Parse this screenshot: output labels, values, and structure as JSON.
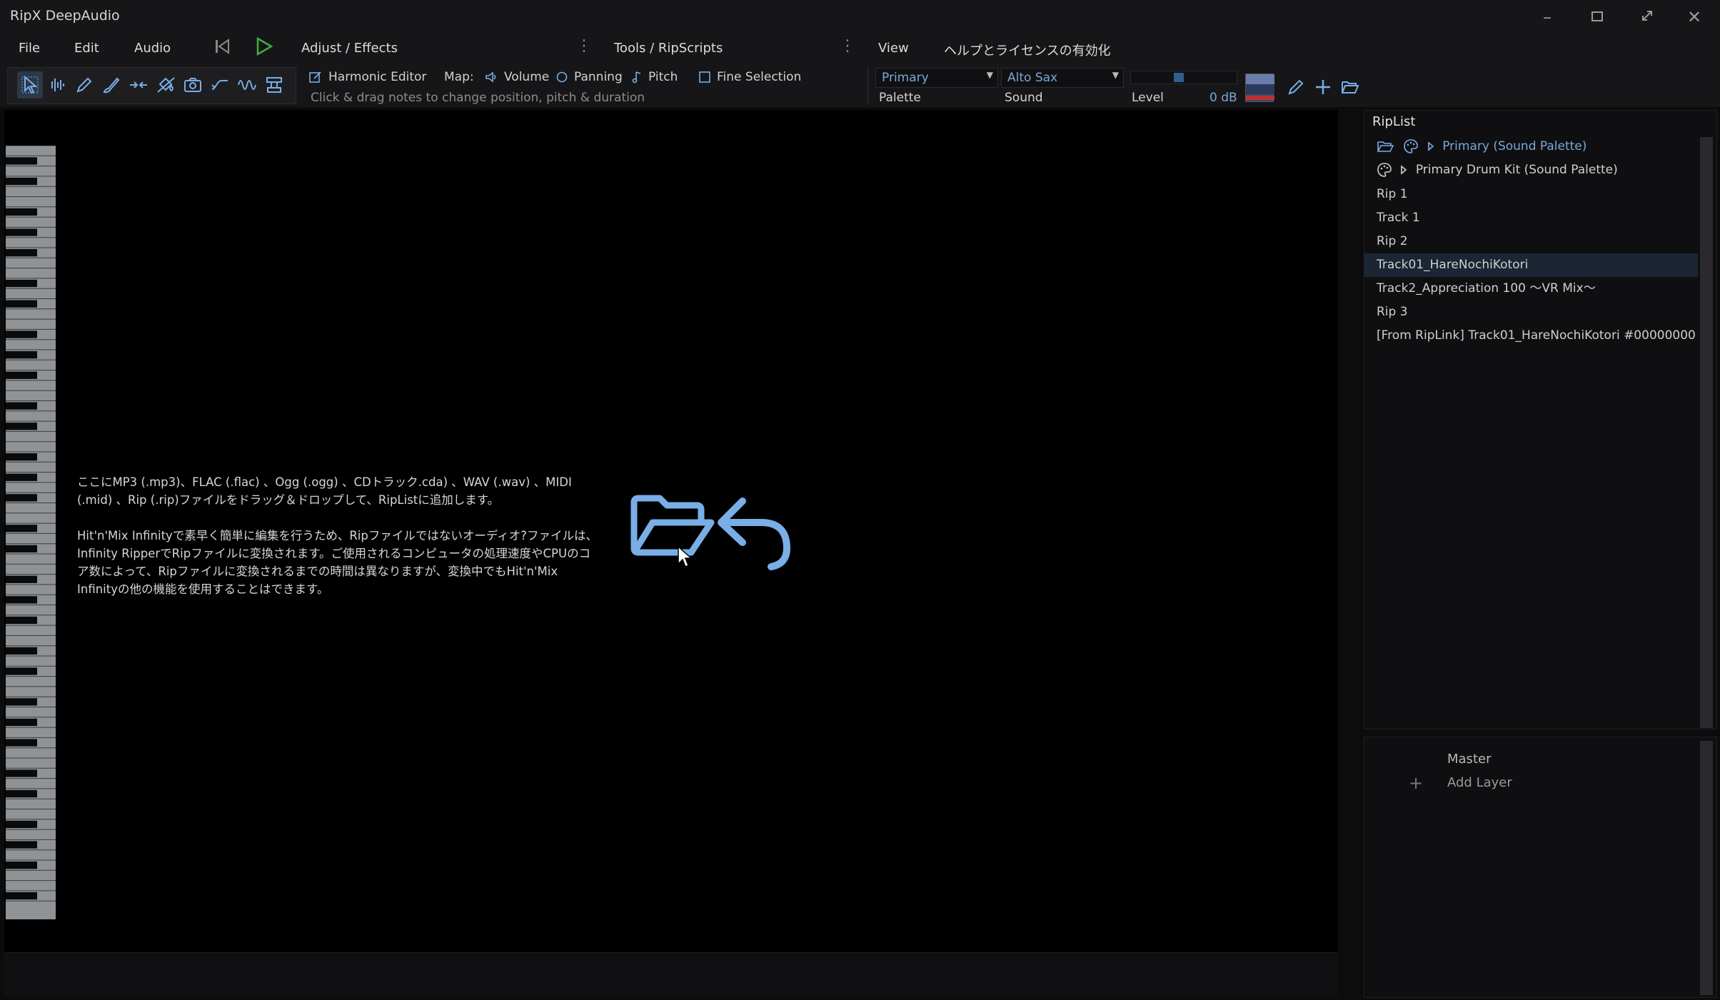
{
  "app": {
    "title": "RipX DeepAudio"
  },
  "menu": {
    "file": "File",
    "edit": "Edit",
    "audio": "Audio",
    "adjust_effects": "Adjust / Effects",
    "tools_ripscripts": "Tools / RipScripts",
    "view": "View",
    "help_license": "ヘルプとライセンスの有効化"
  },
  "toolbar": {
    "harmonic_editor": "Harmonic Editor",
    "map_label": "Map:",
    "volume": "Volume",
    "panning": "Panning",
    "pitch": "Pitch",
    "fine_selection": "Fine Selection",
    "hint": "Click & drag notes to change position, pitch & duration",
    "palette_value": "Primary",
    "palette_label": "Palette",
    "sound_value": "Alto Sax",
    "sound_label": "Sound",
    "level_label": "Level",
    "level_value": "0 dB",
    "level_fraction": 0.45
  },
  "editor": {
    "drop_text_1": "ここにMP3 (.mp3)、FLAC (.flac) 、Ogg (.ogg) 、CDトラック.cda) 、WAV (.wav) 、MIDI (.mid) 、Rip (.rip)ファイルをドラッグ＆ドロップして、RipListに追加します。",
    "drop_text_2": "Hit'n'Mix Infinityで素早く簡単に編集を行うため、Ripファイルではないオーディオ?ファイルは、Infinity RipperでRipファイルに変換されます。ご使用されるコンピュータの処理速度やCPUのコア数によって、Ripファイルに変換されるまでの時間は異なりますが、変換中でもHit'n'Mix Infinityの他の機能を使用することはできます。"
  },
  "riplist": {
    "title": "RipList",
    "items": [
      {
        "label": "Primary (Sound Palette)"
      },
      {
        "label": "Primary Drum Kit (Sound Palette)"
      },
      {
        "label": "Rip 1"
      },
      {
        "label": "Track 1"
      },
      {
        "label": "Rip 2"
      },
      {
        "label": "Track01_HareNochiKotori"
      },
      {
        "label": "Track2_Appreciation 100 ～VR Mix～"
      },
      {
        "label": "Rip 3"
      },
      {
        "label": "[From RipLink] Track01_HareNochiKotori #00000000"
      }
    ]
  },
  "layers": {
    "master": "Master",
    "add_layer": "Add Layer"
  },
  "colors": {
    "accent": "#7aa7d8",
    "icon_blue": "#79aee6",
    "play_green": "#3cb043"
  }
}
